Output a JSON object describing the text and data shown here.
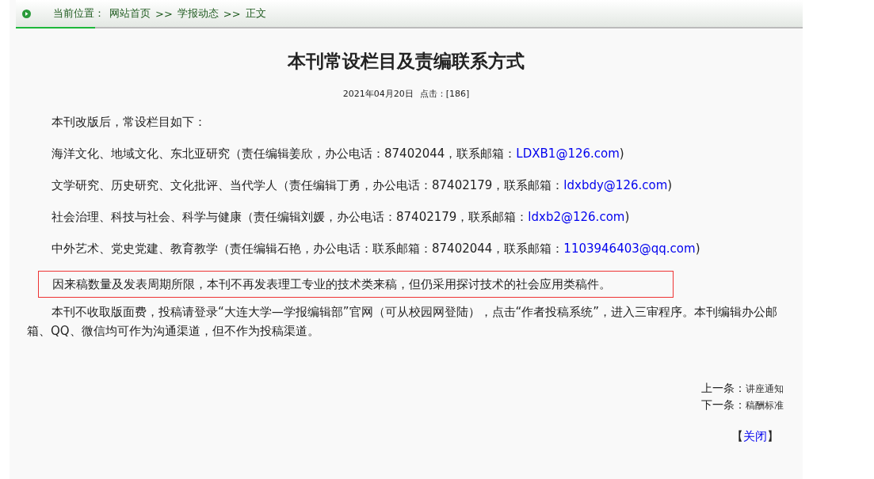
{
  "breadcrumb": {
    "label": "当前位置：",
    "items": [
      {
        "text": "网站首页",
        "sep": ">>"
      },
      {
        "text": "学报动态",
        "sep": ">>"
      },
      {
        "text": "正文"
      }
    ]
  },
  "article": {
    "title": "本刊常设栏目及责编联系方式",
    "date": "2021年04月20日",
    "hits": "点击：[186]",
    "paragraphs": [
      {
        "kind": "text",
        "text": "本刊改版后，常设栏目如下："
      },
      {
        "kind": "column",
        "text": "海洋文化、地域文化、东北亚研究（责任编辑姜欣，办公电话：87402044，联系邮箱：",
        "email": "LDXB1@126.com",
        "after": ")"
      },
      {
        "kind": "column",
        "text": "文学研究、历史研究、文化批评、当代学人（责任编辑丁勇，办公电话：87402179，联系邮箱：",
        "email": "ldxbdy@126.com",
        "after": ")"
      },
      {
        "kind": "column",
        "text": "社会治理、科技与社会、科学与健康（责任编辑刘媛，办公电话：87402179，联系邮箱：",
        "email": "ldxb2@126.com",
        "after": ")"
      },
      {
        "kind": "column",
        "text": "中外艺术、党史党建、教育教学（责任编辑石艳，办公电话：联系邮箱：87402044，联系邮箱：",
        "email": "1103946403@qq.com",
        "after": ")"
      },
      {
        "kind": "notice",
        "text": "因来稿数量及发表周期所限，本刊不再发表理工专业的技术类来稿，但仍采用探讨技术的社会应用类稿件。"
      },
      {
        "kind": "text",
        "text": "本刊不收取版面费，投稿请登录“大连大学—学报编辑部”官网（可从校园网登陆），点击“作者投稿系统”，进入三审程序。本刊编辑办公邮箱、QQ、微信均可作为沟通渠道，但不作为投稿渠道。"
      }
    ]
  },
  "nav": [
    {
      "label": "上一条：",
      "title": "讲座通知"
    },
    {
      "label": "下一条：",
      "title": "稿酬标准"
    }
  ],
  "close": {
    "open": "【",
    "text": "关闭",
    "end": "】"
  }
}
